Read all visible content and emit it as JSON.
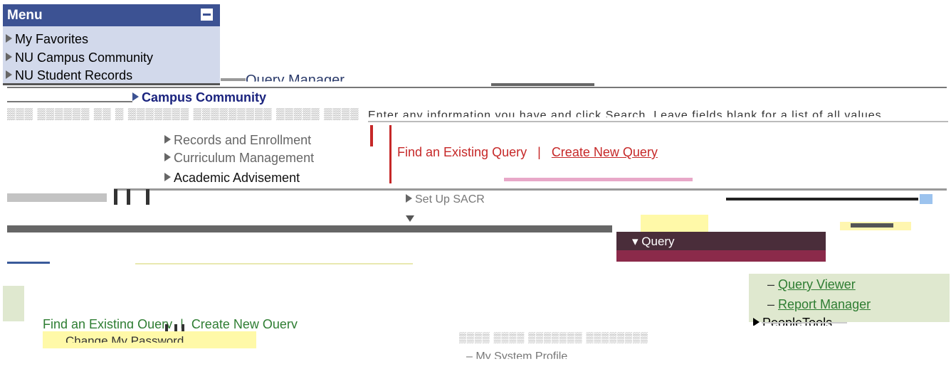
{
  "menu": {
    "title": "Menu",
    "items": [
      "My Favorites",
      "NU Campus Community",
      "NU Student Records"
    ]
  },
  "page": {
    "title_fragment": "Query Manager"
  },
  "sub_nav": {
    "campus": "Campus Community",
    "records": "Records and Enrollment",
    "curriculum": "Curriculum Management",
    "advisement": "Academic Advisement",
    "set_up": "Set Up SACR"
  },
  "instructions": "Enter any information you have and click Search. Leave fields blank for a list of all values.",
  "query_links": {
    "find_existing": "Find an Existing Query",
    "separator": "|",
    "create_new": "Create New Query"
  },
  "right_menu": {
    "query": "Query",
    "query_viewer": "Query Viewer",
    "report_manager": "Report Manager",
    "peopletools": "PeopleTools"
  },
  "bottom": {
    "find_existing": "Find an Existing Query",
    "separator": "|",
    "create_new": "Create New Query",
    "change_password": "Change My Password",
    "my_system_profile": "My System Profile"
  },
  "colors": {
    "menu_header": "#3c5293",
    "menu_body": "#d2d9eb",
    "link_red": "#c62828",
    "query_header": "#4a2d3a",
    "query_row": "#8b2a4a",
    "green_panel": "#dfe8cf",
    "yellow": "#fff9a8"
  }
}
